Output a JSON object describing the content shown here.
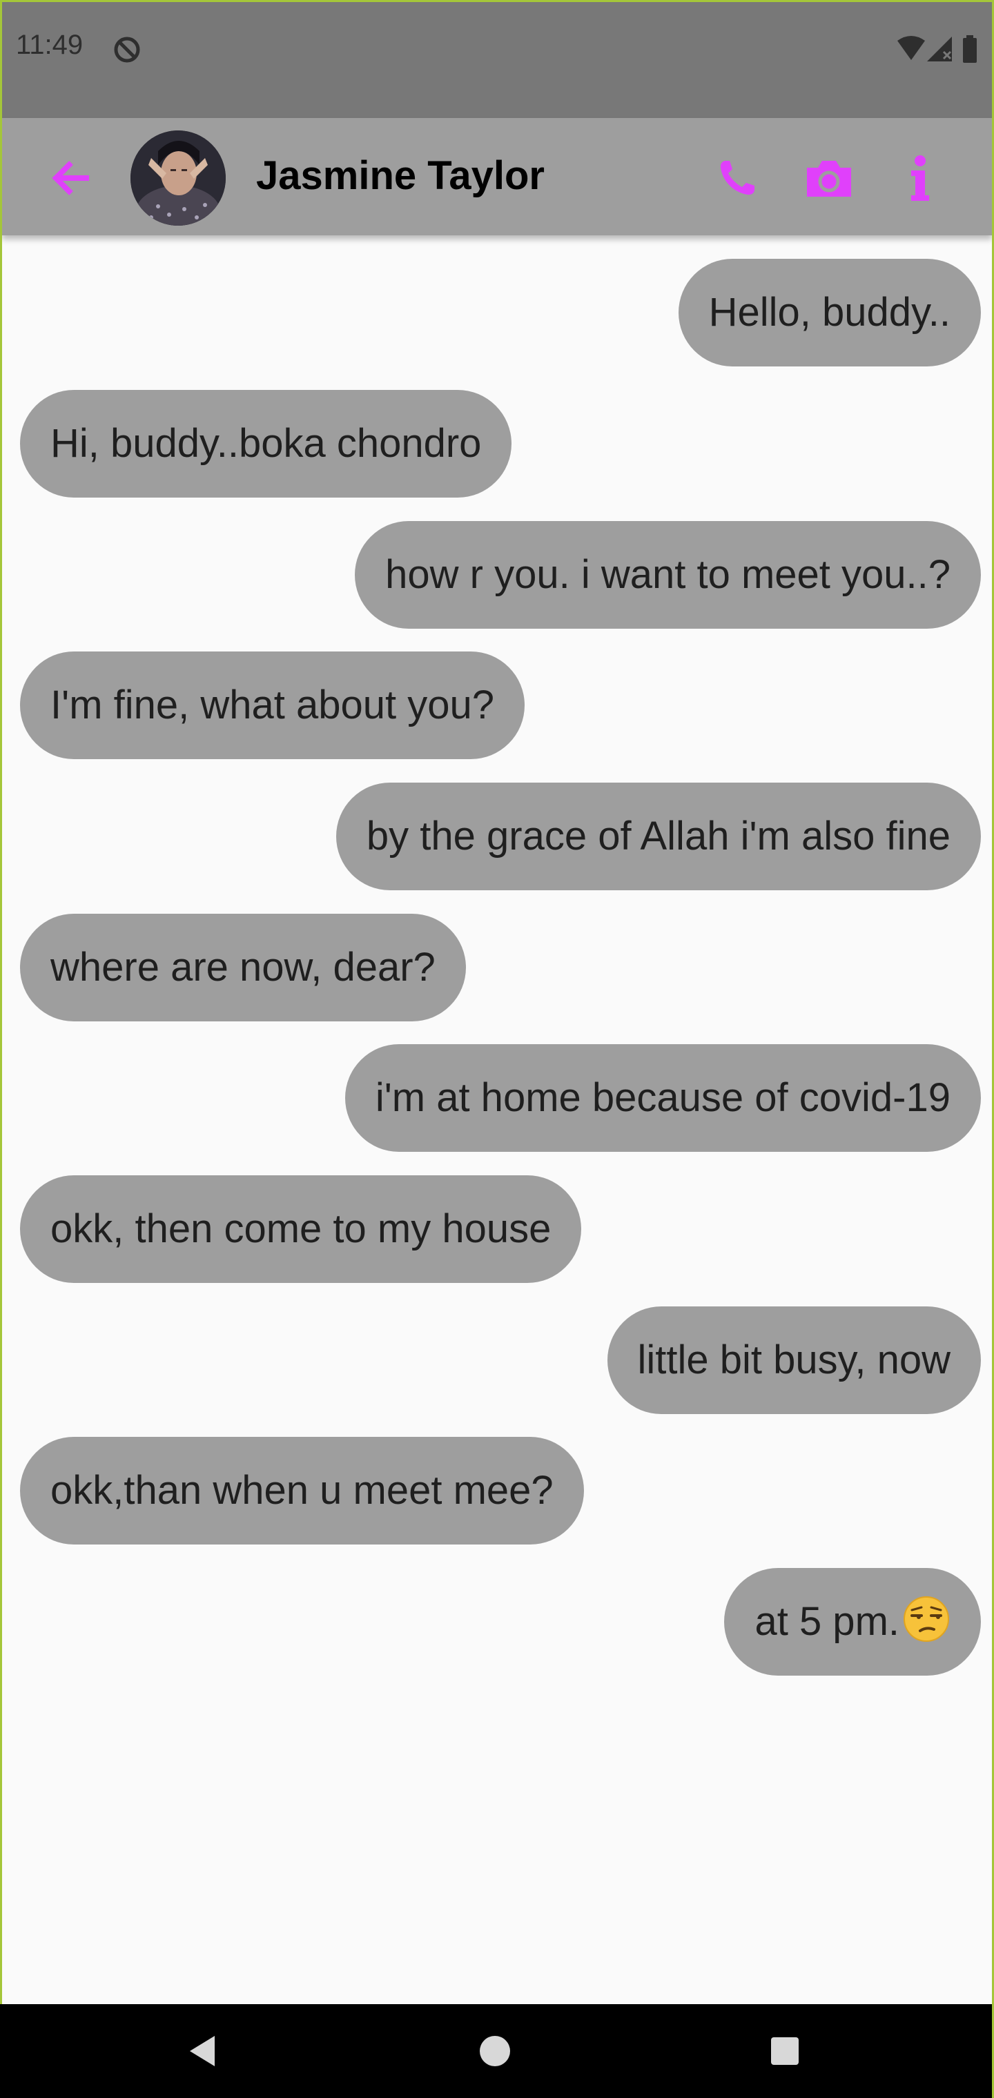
{
  "status_bar": {
    "time": "11:49"
  },
  "app_bar": {
    "contact_name": "Jasmine Taylor",
    "accent_color": "#e040fb",
    "icons": [
      "arrow-back-icon",
      "phone-icon",
      "camera-icon",
      "info-icon"
    ]
  },
  "messages": [
    {
      "side": "sent",
      "text": "Hello, buddy.."
    },
    {
      "side": "received",
      "text": "Hi, buddy..boka chondro"
    },
    {
      "side": "sent",
      "text": "how r you. i want to meet you..?"
    },
    {
      "side": "received",
      "text": "I'm fine, what about you?"
    },
    {
      "side": "sent",
      "text": "by the grace of Allah i'm also fine"
    },
    {
      "side": "received",
      "text": "where are now, dear?"
    },
    {
      "side": "sent",
      "text": "i'm at home because of covid-19"
    },
    {
      "side": "received",
      "text": "okk, then come to my house"
    },
    {
      "side": "sent",
      "text": "little bit busy, now"
    },
    {
      "side": "received",
      "text": "okk,than when u meet mee?"
    },
    {
      "side": "sent",
      "text": "at 5 pm.",
      "emoji": "unamused-face-emoji"
    }
  ],
  "colors": {
    "bubble": "#9e9e9e",
    "chat_background": "#fafafa",
    "app_bar": "#9e9e9e",
    "status_bar": "#787878"
  }
}
